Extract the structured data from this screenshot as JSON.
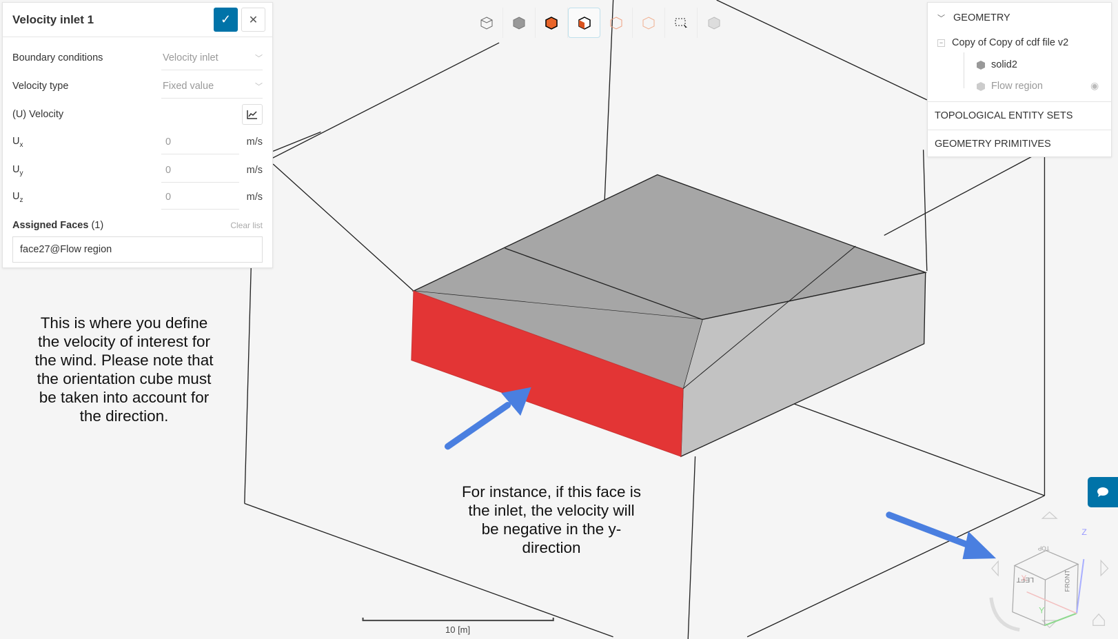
{
  "panel": {
    "title": "Velocity inlet 1",
    "confirm_icon": "check-icon",
    "close_icon": "close-icon",
    "boundary_conditions": {
      "label": "Boundary conditions",
      "value": "Velocity inlet"
    },
    "velocity_type": {
      "label": "Velocity type",
      "value": "Fixed value"
    },
    "velocity_label": "(U) Velocity",
    "ux": {
      "label": "U",
      "sub": "x",
      "value": "0",
      "unit": "m/s"
    },
    "uy": {
      "label": "U",
      "sub": "y",
      "value": "0",
      "unit": "m/s"
    },
    "uz": {
      "label": "U",
      "sub": "z",
      "value": "0",
      "unit": "m/s"
    },
    "assigned_faces_label": "Assigned Faces",
    "assigned_faces_count": "(1)",
    "clear_list": "Clear list",
    "face": "face27@Flow region"
  },
  "tree": {
    "geometry": "GEOMETRY",
    "root": "Copy of Copy of cdf file v2",
    "items": [
      "solid2",
      "Flow region"
    ],
    "topological": "TOPOLOGICAL ENTITY SETS",
    "primitives": "GEOMETRY PRIMITIVES"
  },
  "annotations": {
    "left": [
      "This is where you define",
      "the velocity of interest for",
      "the wind. Please note that",
      "the orientation cube must",
      "be taken into account for",
      "the direction."
    ],
    "bottom": [
      "For instance, if this face is",
      "the inlet, the velocity will",
      "be negative in the y-",
      "direction"
    ]
  },
  "scale": "10 [m]",
  "orientation_cube": {
    "top": "TOP",
    "left": "LEFT",
    "front": "FRONT",
    "axes": [
      "X",
      "Y",
      "Z"
    ]
  },
  "colors": {
    "accent": "#0073a8",
    "face": "#e33535",
    "arrow": "#4a7fe0"
  }
}
